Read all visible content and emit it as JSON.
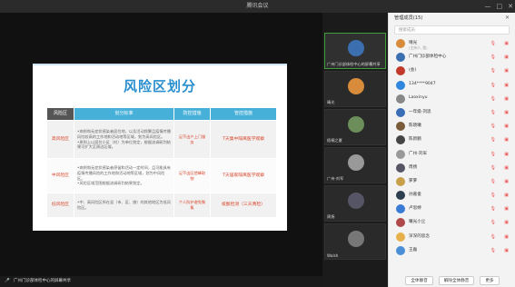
{
  "window": {
    "title": "腾讯会议",
    "controls": [
      "—",
      "□",
      "✕"
    ]
  },
  "slide": {
    "title": "风险区划分",
    "headers": [
      "风险区",
      "划分标准",
      "防控措施",
      "管控措施"
    ],
    "rows": [
      {
        "level": "高风险区",
        "standard": "•病例和无症状感染者居住地，以及活动频繁且疫情传播风险较高的工作地和活动地等区域，划为高风险区。\n•原则上以居住小区（村）为单位划定，根据流调研判结果可扩大至周边区域。",
        "prevention": "足不出户上门服务",
        "control": "7天集中隔离医学观察"
      },
      {
        "level": "中风险区",
        "standard": "•病例和无症状感染者停留和活动一定时间，且可能具有疫情传播风险的工作地和活动地等区域，划为中风险区。\n•风险区域范围根据流调研判结果划定。",
        "prevention": "足不出区错峰取物",
        "control": "7天居家隔离医学观察"
      },
      {
        "level": "低风险区",
        "standard": "•中、高风险区所在县（市、区、旗）的其他地区为低风险区。",
        "prevention": "个人防护避免聚集",
        "control": "核酸检测（三天两检）"
      }
    ]
  },
  "stage_status": "广州门诊部体检中心的屏幕共享",
  "thumbnails": [
    {
      "label": "广州门诊部体检中心的屏幕共享",
      "color": "#3b6fb0"
    },
    {
      "label": "晴光",
      "color": "#d88b3a"
    },
    {
      "label": "梧桐之夏",
      "color": "#6b8e5a"
    },
    {
      "label": "广州-刘军",
      "color": "#999"
    },
    {
      "label": "周扬",
      "color": "#556"
    },
    {
      "label": "Walsh",
      "color": "#777"
    }
  ],
  "panel": {
    "title": "管理成员(15)",
    "search_placeholder": "搜索成员",
    "participants": [
      {
        "name": "晴光",
        "sub": "(主持人, 我)",
        "color": "#d88b3a"
      },
      {
        "name": "广州门诊部体检中心",
        "sub": "",
        "color": "#3b6fb0"
      },
      {
        "name": "(会)",
        "sub": "",
        "color": "#c0392b"
      },
      {
        "name": "134****9047",
        "sub": "",
        "color": "#2e86de"
      },
      {
        "name": "Laoxinyu",
        "sub": "",
        "color": "#888"
      },
      {
        "name": "一年级-刘思",
        "sub": "",
        "color": "#3a6fb7"
      },
      {
        "name": "陈晓曦",
        "sub": "",
        "color": "#7a5c3a"
      },
      {
        "name": "陈新鹏",
        "sub": "",
        "color": "#444"
      },
      {
        "name": "广州-刘军",
        "sub": "",
        "color": "#999"
      },
      {
        "name": "周扬",
        "sub": "",
        "color": "#556"
      },
      {
        "name": "萝萝",
        "sub": "",
        "color": "#c9a04a"
      },
      {
        "name": "孙嘉俊",
        "sub": "",
        "color": "#2c3e50"
      },
      {
        "name": "卢思婷",
        "sub": "",
        "color": "#3a7bd5"
      },
      {
        "name": "曦光小尘",
        "sub": "",
        "color": "#b04a4a"
      },
      {
        "name": "深深的思念",
        "sub": "",
        "color": "#e8b04a"
      },
      {
        "name": "王磊",
        "sub": "",
        "color": "#4a8fd5"
      }
    ],
    "buttons": [
      "全体静音",
      "解除全体静音",
      "更多"
    ]
  }
}
